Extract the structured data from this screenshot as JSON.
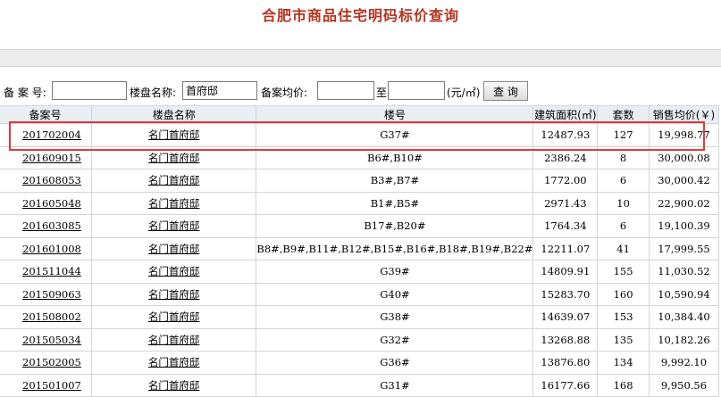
{
  "title": "合肥市商品住宅明码标价查询",
  "search": {
    "record_no_label": "备 案 号:",
    "record_no_value": "",
    "project_label": "楼盘名称:",
    "project_value": "首府邸",
    "price_label": "备案均价:",
    "price_from": "",
    "to_label": "至",
    "price_to": "",
    "unit_label": "(元/㎡)",
    "query_button": "查 询"
  },
  "table": {
    "headers": [
      "备案号",
      "楼盘名称",
      "楼号",
      "建筑面积(㎡)",
      "套数",
      "销售均价(￥)"
    ],
    "rows": [
      {
        "code": "201702004",
        "name": "名门首府邸",
        "building": "G37#",
        "area": "12487.93",
        "units": "127",
        "price": "19,998.77"
      },
      {
        "code": "201609015",
        "name": "名门首府邸",
        "building": "B6#,B10#",
        "area": "2386.24",
        "units": "8",
        "price": "30,000.08"
      },
      {
        "code": "201608053",
        "name": "名门首府邸",
        "building": "B3#,B7#",
        "area": "1772.00",
        "units": "6",
        "price": "30,000.42"
      },
      {
        "code": "201605048",
        "name": "名门首府邸",
        "building": "B1#,B5#",
        "area": "2971.43",
        "units": "10",
        "price": "22,900.02"
      },
      {
        "code": "201603085",
        "name": "名门首府邸",
        "building": "B17#,B20#",
        "area": "1764.34",
        "units": "6",
        "price": "19,100.39"
      },
      {
        "code": "201601008",
        "name": "名门首府邸",
        "building": "B8#,B9#,B11#,B12#,B15#,B16#,B18#,B19#,B22#",
        "area": "12211.07",
        "units": "41",
        "price": "17,999.55"
      },
      {
        "code": "201511044",
        "name": "名门首府邸",
        "building": "G39#",
        "area": "14809.91",
        "units": "155",
        "price": "11,030.52"
      },
      {
        "code": "201509063",
        "name": "名门首府邸",
        "building": "G40#",
        "area": "15283.70",
        "units": "160",
        "price": "10,590.94"
      },
      {
        "code": "201508002",
        "name": "名门首府邸",
        "building": "G38#",
        "area": "14639.07",
        "units": "153",
        "price": "10,384.40"
      },
      {
        "code": "201505034",
        "name": "名门首府邸",
        "building": "G32#",
        "area": "13268.88",
        "units": "135",
        "price": "10,182.26"
      },
      {
        "code": "201502005",
        "name": "名门首府邸",
        "building": "G36#",
        "area": "13876.80",
        "units": "134",
        "price": "9,992.10"
      },
      {
        "code": "201501007",
        "name": "名门首府邸",
        "building": "G31#",
        "area": "16177.66",
        "units": "168",
        "price": "9,950.56"
      }
    ]
  },
  "colors": {
    "title": "#b5331e",
    "highlight": "#e03a3a",
    "header_bg": "#e9eef4"
  }
}
